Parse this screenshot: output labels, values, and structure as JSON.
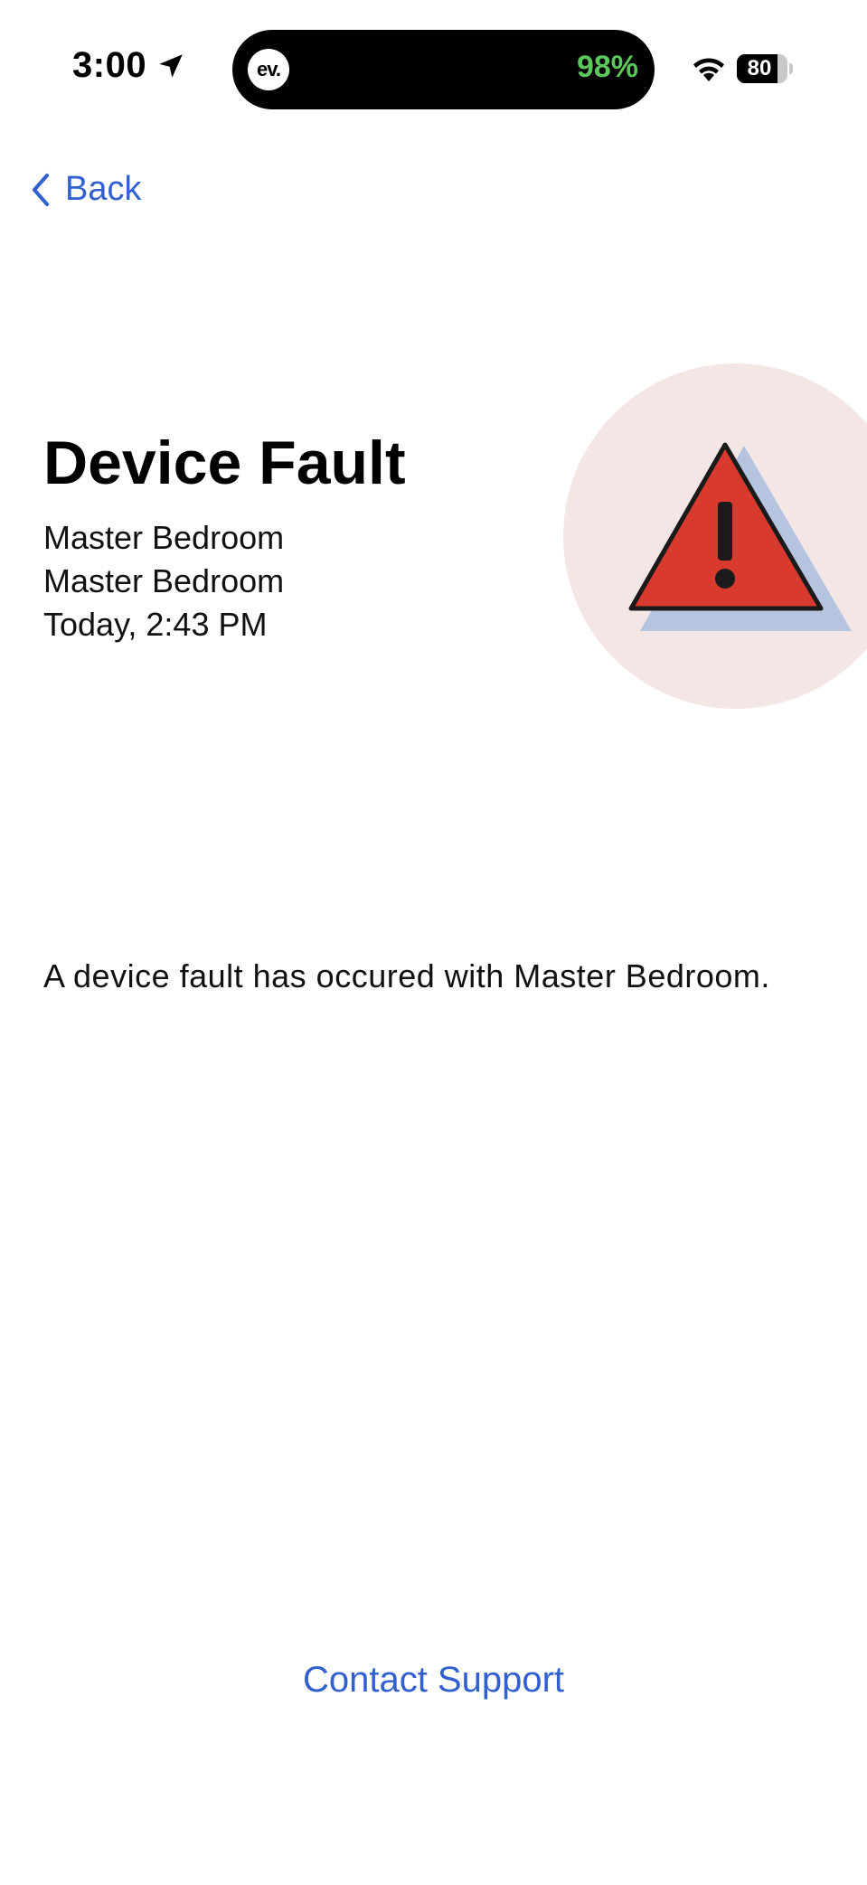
{
  "status_bar": {
    "time": "3:00",
    "location_icon": "location-arrow-icon",
    "island_app_icon_text": "ev.",
    "island_percent": "98%",
    "island_percent_color": "#5ac85a",
    "wifi_icon": "wifi-icon",
    "battery_level": 80,
    "battery_text": "80"
  },
  "nav": {
    "back_label": "Back",
    "back_icon": "chevron-left-icon",
    "accent_color": "#3260cf"
  },
  "alert": {
    "title": "Device Fault",
    "device_name": "Master Bedroom",
    "room_name": "Master Bedroom",
    "timestamp": "Today, 2:43 PM",
    "icon": "warning-triangle-icon",
    "icon_color": "#d83a2e",
    "icon_shadow_color": "#b5c5e0",
    "circle_color": "#f5e6e6",
    "message": "A device fault has occured with Master Bedroom."
  },
  "footer": {
    "contact_support_label": "Contact Support"
  }
}
